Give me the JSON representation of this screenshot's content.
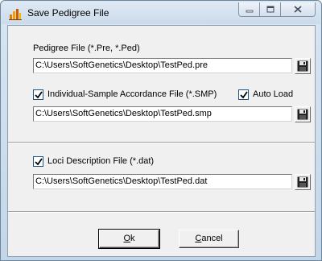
{
  "window": {
    "title": "Save Pedigree File"
  },
  "pedigree": {
    "label": "Pedigree File (*.Pre, *.Ped)",
    "path": "C:\\Users\\SoftGenetics\\Desktop\\TestPed.pre"
  },
  "accordance": {
    "label": "Individual-Sample Accordance File (*.SMP)",
    "checked": true,
    "auto_load_label": "Auto Load",
    "auto_load_checked": true,
    "path": "C:\\Users\\SoftGenetics\\Desktop\\TestPed.smp"
  },
  "loci": {
    "label": "Loci Description File (*.dat)",
    "checked": true,
    "path": "C:\\Users\\SoftGenetics\\Desktop\\TestPed.dat"
  },
  "buttons": {
    "ok_accel": "O",
    "ok_rest": "k",
    "cancel_accel": "C",
    "cancel_rest": "ancel"
  },
  "icons": {
    "app": "pedigree-chart-icon",
    "save": "floppy-disk-icon"
  }
}
